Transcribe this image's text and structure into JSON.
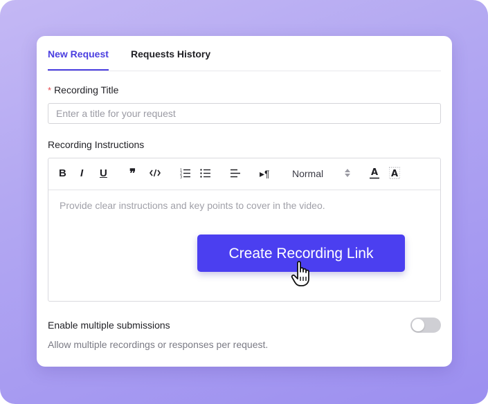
{
  "tabs": [
    {
      "label": "New Request",
      "active": true
    },
    {
      "label": "Requests History",
      "active": false
    }
  ],
  "title_field": {
    "required_mark": "*",
    "label": "Recording Title",
    "placeholder": "Enter a title for your request",
    "value": ""
  },
  "instructions": {
    "label": "Recording Instructions",
    "placeholder": "Provide clear instructions and key points to cover in the video.",
    "toolbar": {
      "icons": [
        "bold-icon",
        "italic-icon",
        "underline-icon",
        "blockquote-icon",
        "code-icon",
        "ordered-list-icon",
        "bullet-list-icon",
        "align-icon",
        "text-direction-icon",
        "font-color-icon",
        "highlight-color-icon"
      ],
      "bold_label": "B",
      "italic_label": "I",
      "underline_label": "U",
      "quote_label": "❞",
      "direction_label": "▸¶",
      "format_select": "Normal"
    }
  },
  "cta": {
    "label": "Create Recording Link"
  },
  "multiple_submissions": {
    "label": "Enable multiple submissions",
    "description": "Allow multiple recordings or responses per request.",
    "enabled": false
  },
  "colors": {
    "accent": "#4b3ff0",
    "tab_active": "#4a3ee0",
    "required": "#e5484d"
  }
}
